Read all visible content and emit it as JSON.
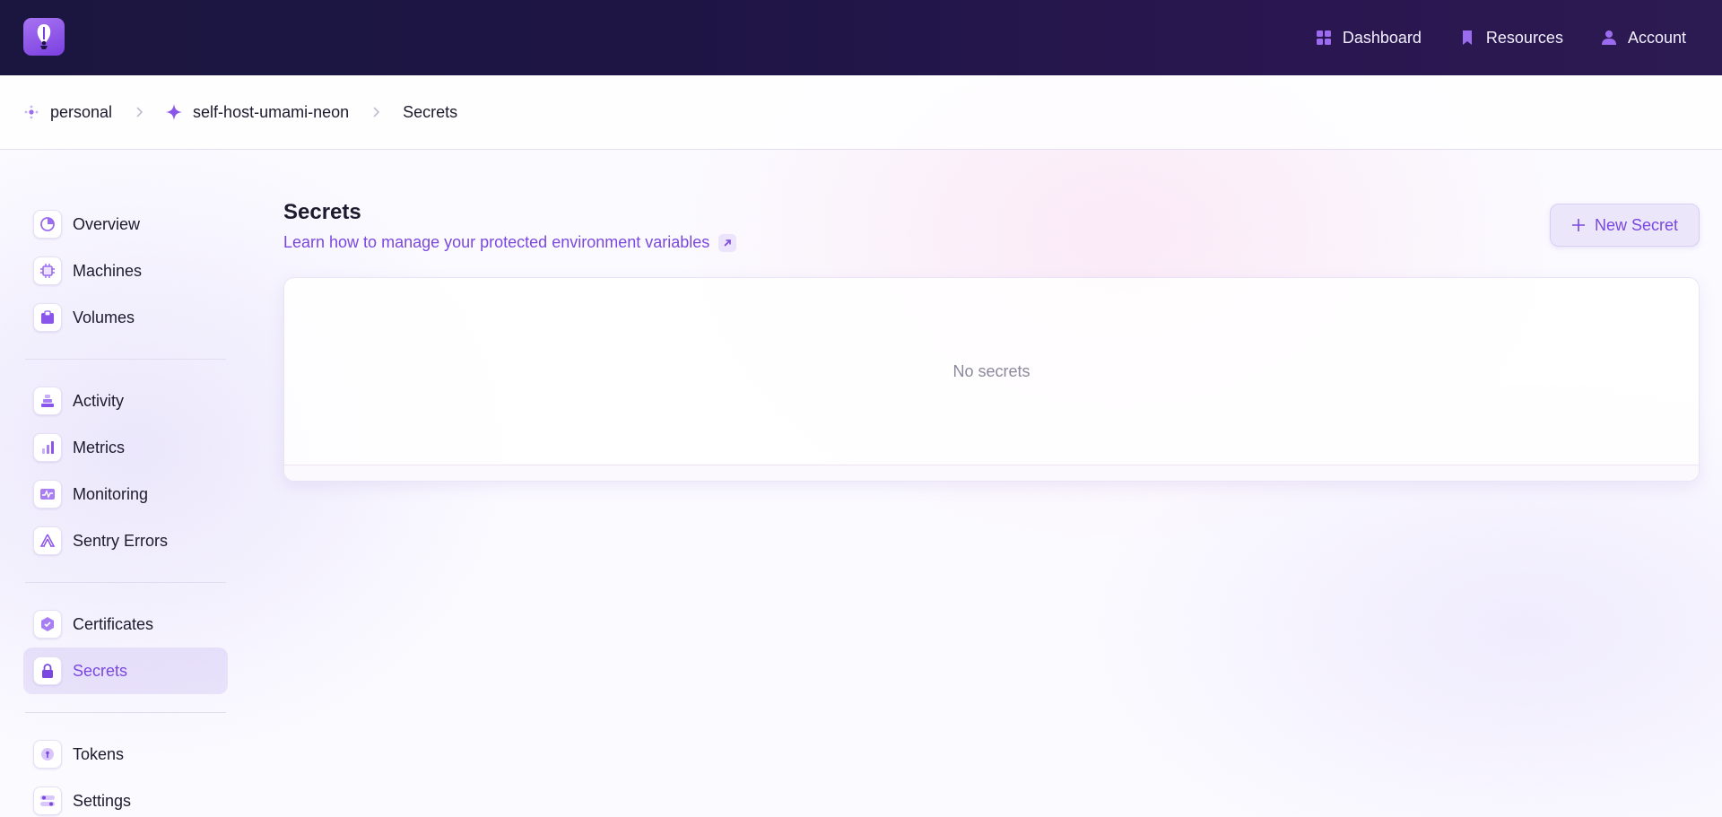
{
  "colors": {
    "accent": "#7a47e0",
    "topbar": "#1e1545",
    "active_bg": "#e8e1f8"
  },
  "topnav": [
    {
      "label": "Dashboard",
      "icon": "dashboard-icon"
    },
    {
      "label": "Resources",
      "icon": "bookmark-icon"
    },
    {
      "label": "Account",
      "icon": "user-icon"
    }
  ],
  "breadcrumb": [
    {
      "label": "personal",
      "icon": "org-icon"
    },
    {
      "label": "self-host-umami-neon",
      "icon": "sparkle-icon"
    },
    {
      "label": "Secrets"
    }
  ],
  "sidebar": {
    "groups": [
      [
        {
          "label": "Overview",
          "icon": "overview-icon"
        },
        {
          "label": "Machines",
          "icon": "chip-icon"
        },
        {
          "label": "Volumes",
          "icon": "volume-icon"
        }
      ],
      [
        {
          "label": "Activity",
          "icon": "activity-icon"
        },
        {
          "label": "Metrics",
          "icon": "metrics-icon"
        },
        {
          "label": "Monitoring",
          "icon": "monitoring-icon"
        },
        {
          "label": "Sentry Errors",
          "icon": "sentry-icon"
        }
      ],
      [
        {
          "label": "Certificates",
          "icon": "certificate-icon"
        },
        {
          "label": "Secrets",
          "icon": "lock-icon",
          "active": true
        }
      ],
      [
        {
          "label": "Tokens",
          "icon": "token-icon"
        },
        {
          "label": "Settings",
          "icon": "settings-icon"
        }
      ]
    ]
  },
  "main": {
    "title": "Secrets",
    "learn_link": "Learn how to manage your protected environment variables",
    "new_button": "New Secret",
    "empty_state": "No secrets"
  }
}
